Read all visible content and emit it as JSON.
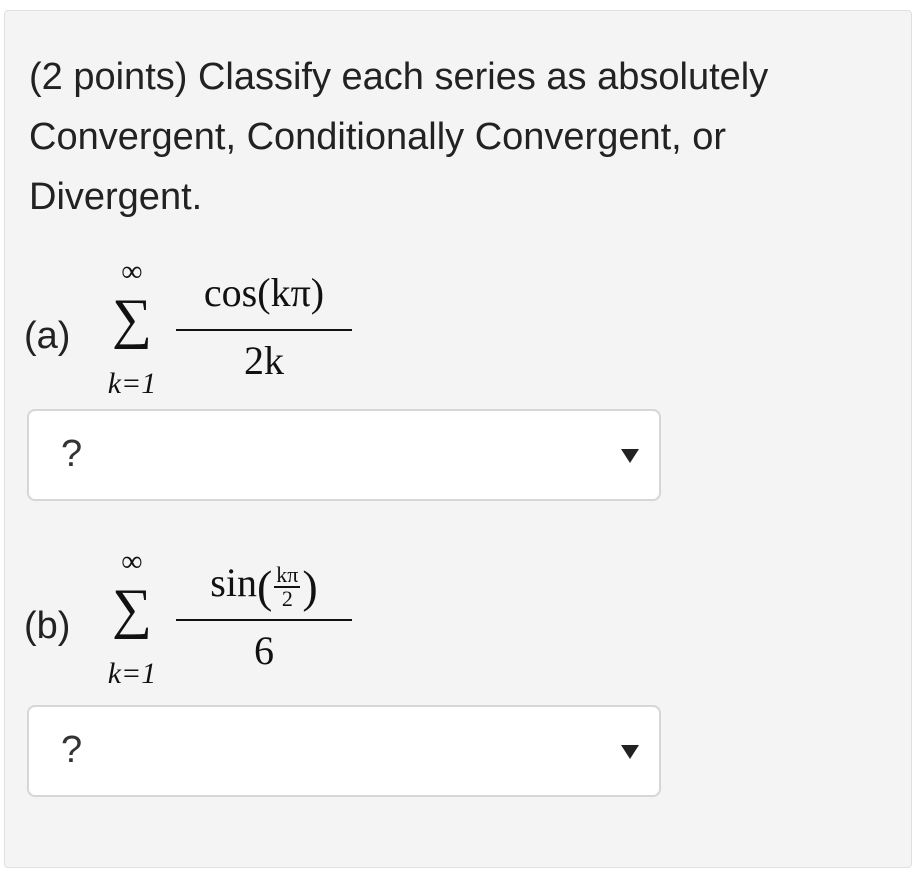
{
  "question": {
    "prompt": "(2 points) Classify each series as absolutely Convergent, Conditionally Convergent, or Divergent."
  },
  "parts": [
    {
      "label": "(a)",
      "sum_upper": "∞",
      "sum_lower": "k=1",
      "numerator": "cos(kπ)",
      "denominator": "2k",
      "select_value": "?"
    },
    {
      "label": "(b)",
      "sum_upper": "∞",
      "sum_lower": "k=1",
      "numerator_func": "sin",
      "numerator_inner_num": "kπ",
      "numerator_inner_den": "2",
      "denominator": "6",
      "select_value": "?"
    }
  ],
  "icons": {
    "dropdown": "caret-down-icon"
  }
}
